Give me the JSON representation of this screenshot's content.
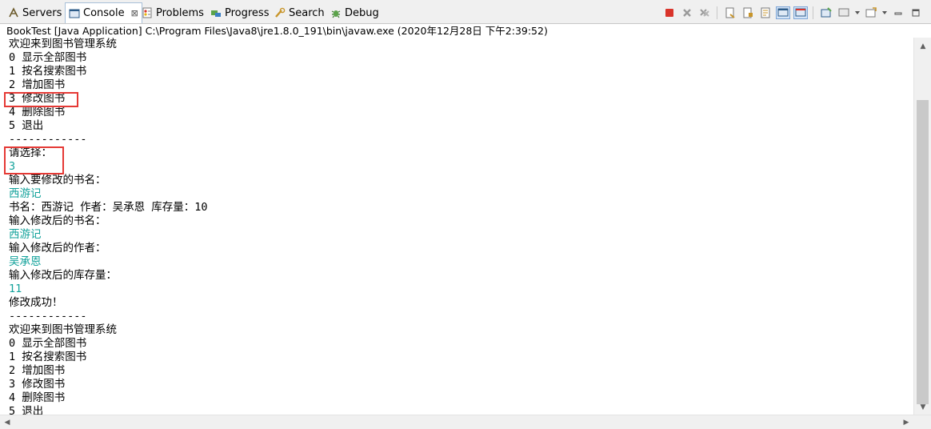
{
  "tabs": [
    {
      "label": "Servers",
      "icon": "servers-icon"
    },
    {
      "label": "Console",
      "icon": "console-icon",
      "active": true,
      "close": "⊠"
    },
    {
      "label": "Problems",
      "icon": "problems-icon"
    },
    {
      "label": "Progress",
      "icon": "progress-icon"
    },
    {
      "label": "Search",
      "icon": "search-icon"
    },
    {
      "label": "Debug",
      "icon": "debug-icon"
    }
  ],
  "launch_info": "BookTest [Java Application] C:\\Program Files\\Java8\\jre1.8.0_191\\bin\\javaw.exe (2020年12月28日 下午2:39:52)",
  "console_lines": [
    {
      "text": "欢迎来到图书管理系统",
      "type": "out"
    },
    {
      "text": "0 显示全部图书",
      "type": "out"
    },
    {
      "text": "1 按名搜索图书",
      "type": "out"
    },
    {
      "text": "2 增加图书",
      "type": "out"
    },
    {
      "text": "3 修改图书",
      "type": "out"
    },
    {
      "text": "4 删除图书",
      "type": "out"
    },
    {
      "text": "5 退出",
      "type": "out"
    },
    {
      "text": "------------",
      "type": "out"
    },
    {
      "text": "请选择：",
      "type": "out"
    },
    {
      "text": "3",
      "type": "in"
    },
    {
      "text": "输入要修改的书名：",
      "type": "out"
    },
    {
      "text": "西游记",
      "type": "in"
    },
    {
      "text": "书名：西游记 作者：吴承恩 库存量：10",
      "type": "out"
    },
    {
      "text": "输入修改后的书名：",
      "type": "out"
    },
    {
      "text": "西游记",
      "type": "in"
    },
    {
      "text": "输入修改后的作者：",
      "type": "out"
    },
    {
      "text": "吴承恩",
      "type": "in"
    },
    {
      "text": "输入修改后的库存量：",
      "type": "out"
    },
    {
      "text": "11",
      "type": "in"
    },
    {
      "text": "修改成功！",
      "type": "out"
    },
    {
      "text": "------------",
      "type": "out"
    },
    {
      "text": "欢迎来到图书管理系统",
      "type": "out"
    },
    {
      "text": "0 显示全部图书",
      "type": "out"
    },
    {
      "text": "1 按名搜索图书",
      "type": "out"
    },
    {
      "text": "2 增加图书",
      "type": "out"
    },
    {
      "text": "3 修改图书",
      "type": "out"
    },
    {
      "text": "4 删除图书",
      "type": "out"
    },
    {
      "text": "5 退出",
      "type": "out"
    }
  ],
  "colors": {
    "input_text": "#13a29b",
    "highlight_box": "#e53935",
    "terminate_button": "#d9342b"
  }
}
